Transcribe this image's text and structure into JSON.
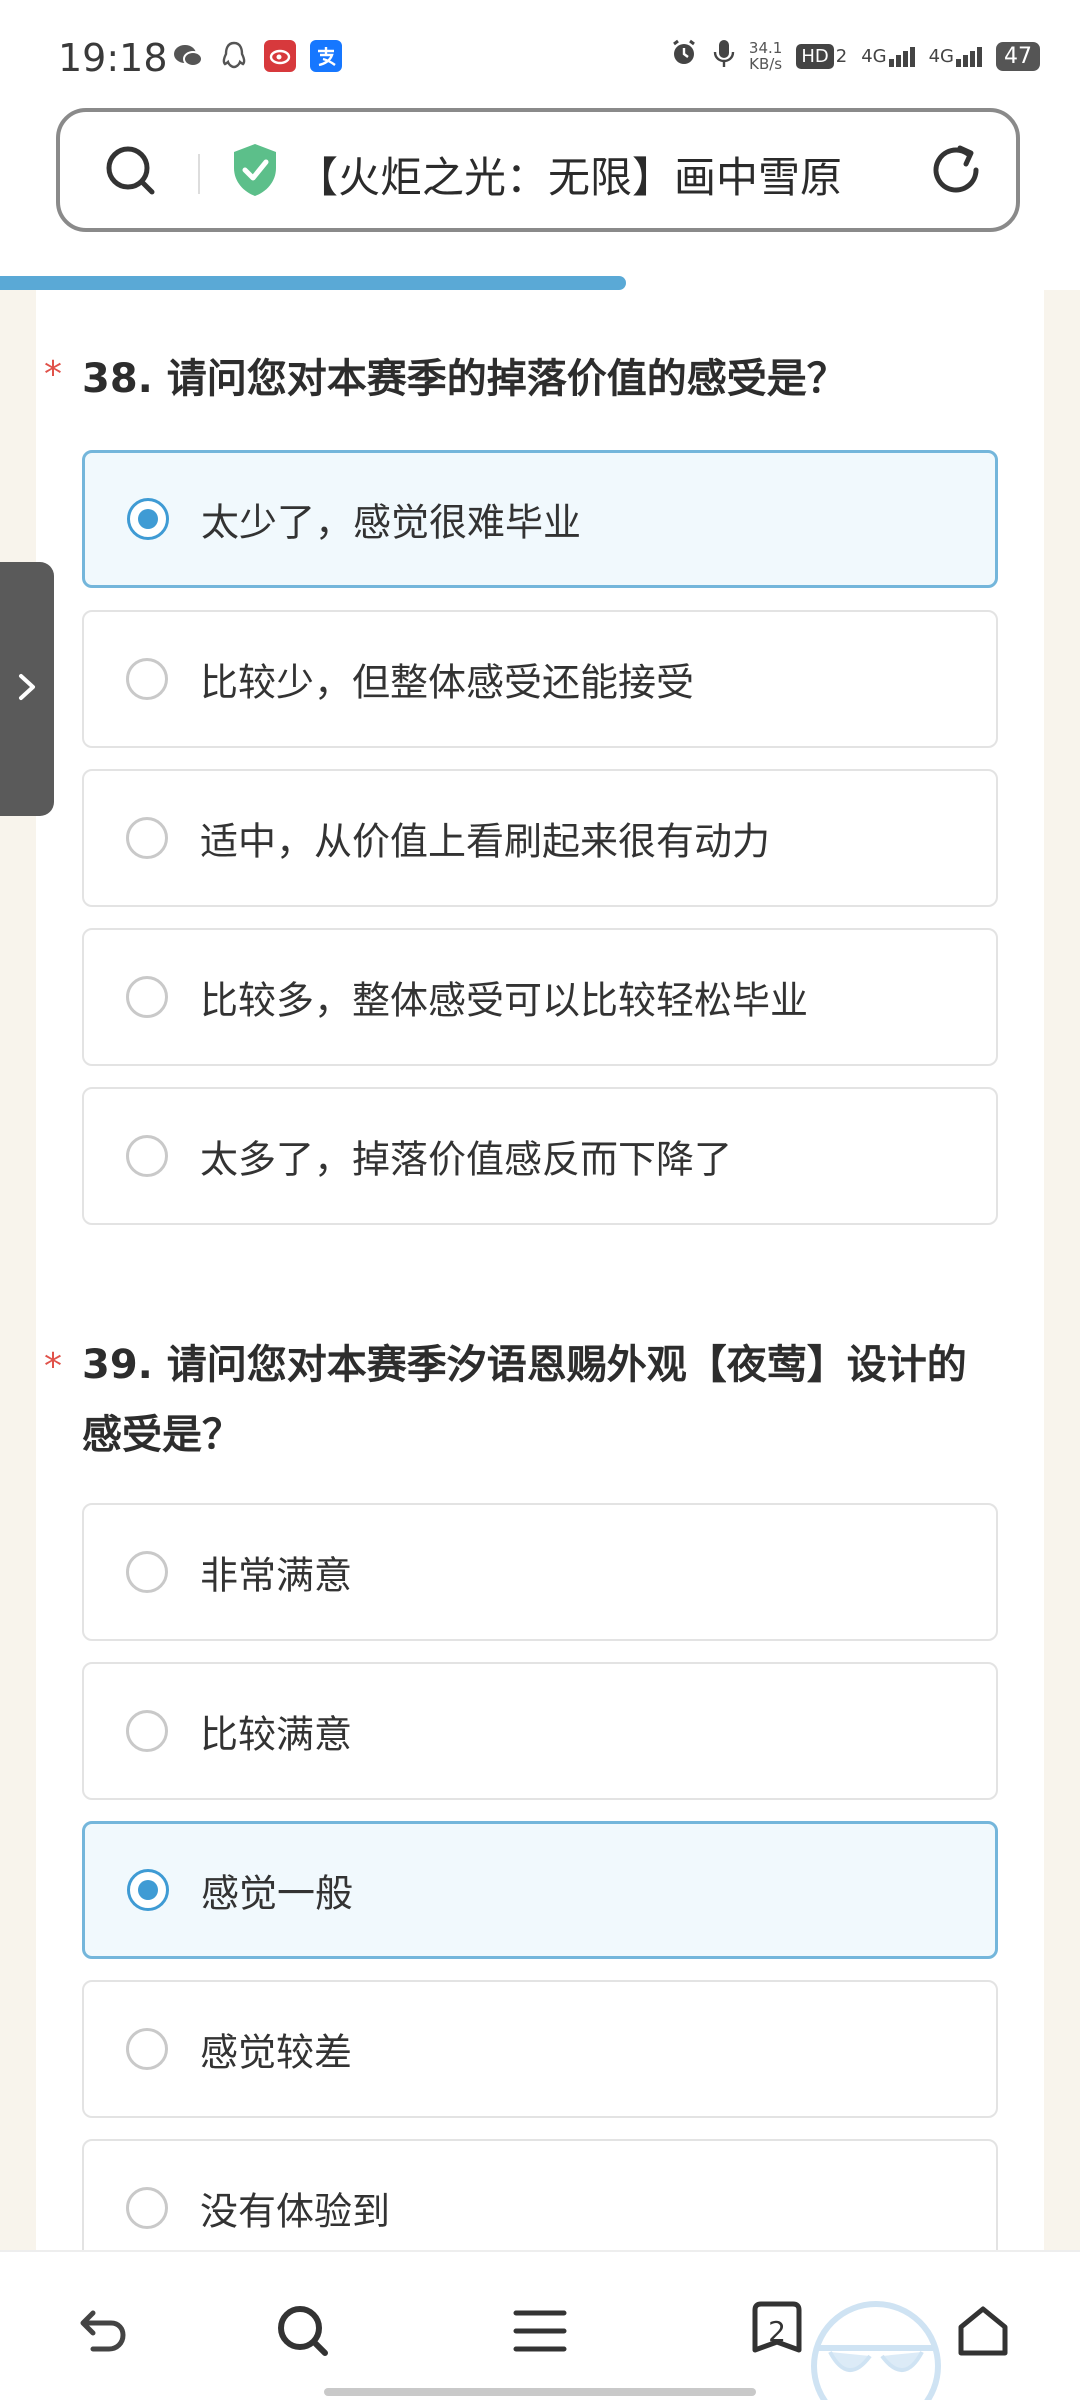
{
  "status": {
    "time": "19:18",
    "net_rate_value": "34.1",
    "net_rate_unit": "KB/s",
    "hd_label": "HD",
    "hd_sub": "2",
    "net1": "4G",
    "net2": "4G",
    "battery": "47"
  },
  "address_bar": {
    "title": "【火炬之光：无限】画中雪原",
    "shield_color": "#5cbf8a"
  },
  "progress": {
    "fraction": 0.58
  },
  "questions": [
    {
      "title": "38. 请问您对本赛季的掉落价值的感受是？",
      "required": "*",
      "options": [
        {
          "label": "太少了，感觉很难毕业",
          "selected": true
        },
        {
          "label": "比较少，但整体感受还能接受",
          "selected": false
        },
        {
          "label": "适中，从价值上看刷起来很有动力",
          "selected": false
        },
        {
          "label": "比较多，整体感受可以比较轻松毕业",
          "selected": false
        },
        {
          "label": "太多了，掉落价值感反而下降了",
          "selected": false
        }
      ]
    },
    {
      "title_line1": "39. 请问您对本赛季汐语恩赐外观【夜莺】设计的",
      "title_line2": "感受是？",
      "required": "*",
      "options": [
        {
          "label": "非常满意",
          "selected": false
        },
        {
          "label": "比较满意",
          "selected": false
        },
        {
          "label": "感觉一般",
          "selected": true
        },
        {
          "label": "感觉较差",
          "selected": false
        },
        {
          "label": "没有体验到",
          "selected": false
        }
      ]
    }
  ],
  "bottom_nav": {
    "tab_count": "2"
  },
  "colors": {
    "accent": "#3f9bd4",
    "progress": "#5aa9d6",
    "required": "#e0524a"
  }
}
